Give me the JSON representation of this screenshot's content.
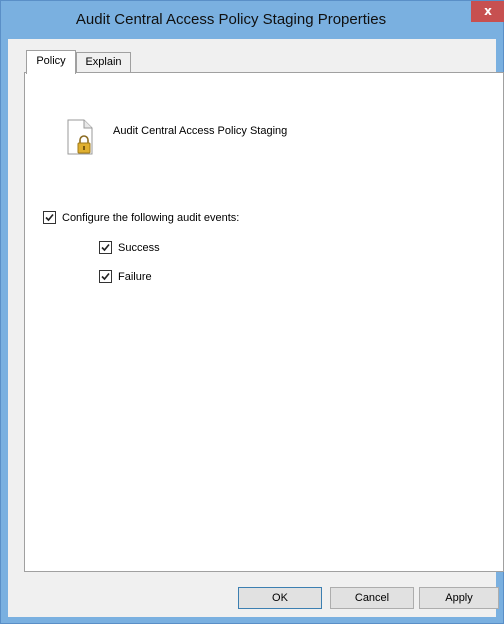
{
  "window": {
    "title": "Audit Central Access Policy Staging Properties",
    "close_label": "x"
  },
  "tabs": [
    {
      "label": "Policy",
      "active": true
    },
    {
      "label": "Explain",
      "active": false
    }
  ],
  "policy": {
    "name": "Audit Central Access Policy Staging",
    "icon": "locked-file-icon"
  },
  "audit": {
    "configure_label": "Configure the following audit events:",
    "configure_checked": true,
    "success_label": "Success",
    "success_checked": true,
    "failure_label": "Failure",
    "failure_checked": true
  },
  "buttons": {
    "ok": "OK",
    "cancel": "Cancel",
    "apply": "Apply"
  },
  "colors": {
    "frame": "#7ab0e0",
    "close": "#c75050",
    "client": "#f0f0f0"
  }
}
